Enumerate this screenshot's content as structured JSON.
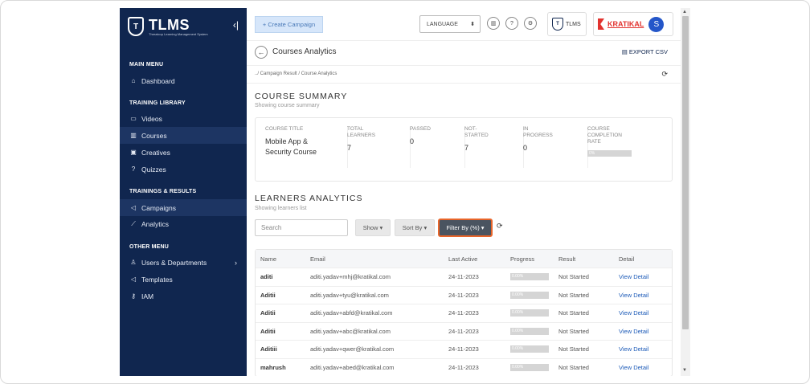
{
  "sidebar": {
    "brand": "TLMS",
    "brand_sub": "Threatcop Learning Management System",
    "logo_letter": "T",
    "collapse_icon": "‹|",
    "sections": {
      "main": "MAIN MENU",
      "training": "TRAINING LIBRARY",
      "results": "TRAININGS & RESULTS",
      "other": "OTHER MENU"
    },
    "items": {
      "dashboard": "Dashboard",
      "videos": "Videos",
      "courses": "Courses",
      "creatives": "Creatives",
      "quizzes": "Quizzes",
      "campaigns": "Campaigns",
      "analytics": "Analytics",
      "users": "Users & Departments",
      "templates": "Templates",
      "iam": "IAM"
    }
  },
  "topbar": {
    "create_campaign": "+ Create Campaign",
    "language": "LANGUAGE",
    "tlms_label": "TLMS",
    "kratikal": "KRATIKAL",
    "avatar_letter": "S"
  },
  "page": {
    "title": "Courses Analytics",
    "export": "EXPORT CSV",
    "breadcrumb": "../ Campaign Result / Course Analytics"
  },
  "summary": {
    "heading": "COURSE SUMMARY",
    "subheading": "Showing course summary",
    "course_title_label": "COURSE TITLE",
    "course_title_value": "Mobile App & Security Course",
    "total_label": "TOTAL LEARNERS",
    "total_value": "7",
    "passed_label": "PASSED",
    "passed_value": "0",
    "not_started_label": "NOT-STARTED",
    "not_started_value": "7",
    "in_progress_label": "IN PROGRESS",
    "in_progress_value": "0",
    "completion_label": "COURSE COMPLETION RATE",
    "completion_value": "0%",
    "completion_fraction": 0
  },
  "learners": {
    "heading": "LEARNERS ANALYTICS",
    "subheading": "Showing learners list",
    "search_placeholder": "Search",
    "show": "Show",
    "sort_by": "Sort By",
    "filter_by": "Filter By (%)",
    "columns": {
      "name": "Name",
      "email": "Email",
      "last_active": "Last Active",
      "progress": "Progress",
      "result": "Result",
      "detail": "Detail"
    },
    "rows": [
      {
        "name": "aditi",
        "email": "aditi.yadav+mhj@kratikal.com",
        "last_active": "24-11-2023",
        "progress": "0.00%",
        "result": "Not Started",
        "detail": "View Detail"
      },
      {
        "name": "Aditii",
        "email": "aditi.yadav+tyu@kratikal.com",
        "last_active": "24-11-2023",
        "progress": "0.00%",
        "result": "Not Started",
        "detail": "View Detail"
      },
      {
        "name": "Aditii",
        "email": "aditi.yadav+abfd@kratikal.com",
        "last_active": "24-11-2023",
        "progress": "0.00%",
        "result": "Not Started",
        "detail": "View Detail"
      },
      {
        "name": "Aditii",
        "email": "aditi.yadav+abc@kratikal.com",
        "last_active": "24-11-2023",
        "progress": "0.00%",
        "result": "Not Started",
        "detail": "View Detail"
      },
      {
        "name": "Aditiii",
        "email": "aditi.yadav+qwer@kratikal.com",
        "last_active": "24-11-2023",
        "progress": "0.00%",
        "result": "Not Started",
        "detail": "View Detail"
      },
      {
        "name": "mahrush",
        "email": "aditi.yadav+abed@kratikal.com",
        "last_active": "24-11-2023",
        "progress": "0.00%",
        "result": "Not Started",
        "detail": "View Detail"
      }
    ]
  }
}
